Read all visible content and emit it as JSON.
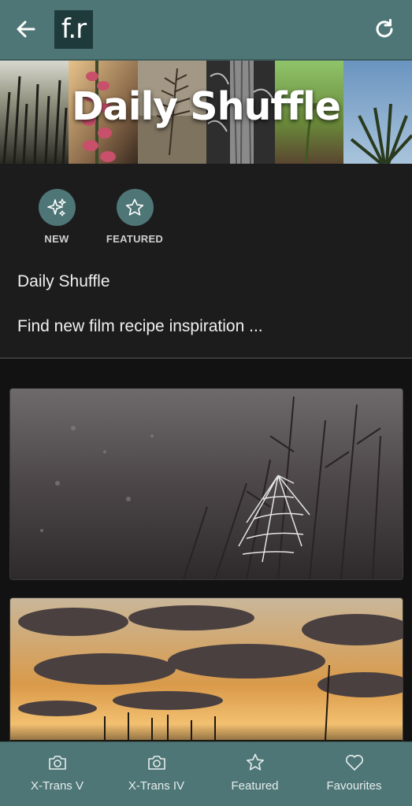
{
  "header": {
    "logo_text": "f.r",
    "back_icon": "arrow-left-icon",
    "refresh_icon": "refresh-icon",
    "color": "#4f7676"
  },
  "banner": {
    "title": "Daily Shuffle"
  },
  "filters": [
    {
      "label": "NEW",
      "icon": "sparkles-icon"
    },
    {
      "label": "FEATURED",
      "icon": "star-icon"
    }
  ],
  "collection": {
    "title": "Daily Shuffle",
    "description": "Find new film recipe inspiration ..."
  },
  "photos": [
    {
      "subject": "spider-web"
    },
    {
      "subject": "sunset-clouds"
    }
  ],
  "bottom_nav": [
    {
      "label": "X-Trans V",
      "icon": "camera-icon"
    },
    {
      "label": "X-Trans IV",
      "icon": "camera-icon"
    },
    {
      "label": "Featured",
      "icon": "star-icon"
    },
    {
      "label": "Favourites",
      "icon": "heart-icon"
    }
  ]
}
